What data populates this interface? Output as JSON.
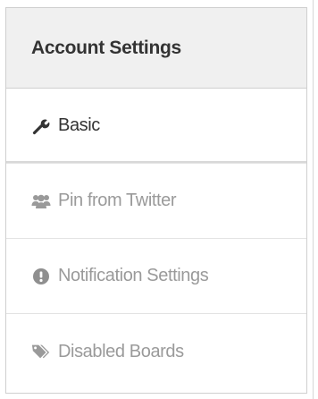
{
  "panel": {
    "title": "Account Settings"
  },
  "menu": {
    "items": [
      {
        "label": "Basic",
        "icon": "wrench-icon",
        "active": true
      },
      {
        "label": "Pin from Twitter",
        "icon": "users-icon",
        "active": false
      },
      {
        "label": "Notification Settings",
        "icon": "exclamation-circle-icon",
        "active": false
      },
      {
        "label": "Disabled Boards",
        "icon": "tags-icon",
        "active": false
      }
    ]
  },
  "colors": {
    "active_text": "#333333",
    "inactive_text": "#9a9a9a",
    "header_bg": "#f0f0f0",
    "border": "#cfcfcf"
  }
}
